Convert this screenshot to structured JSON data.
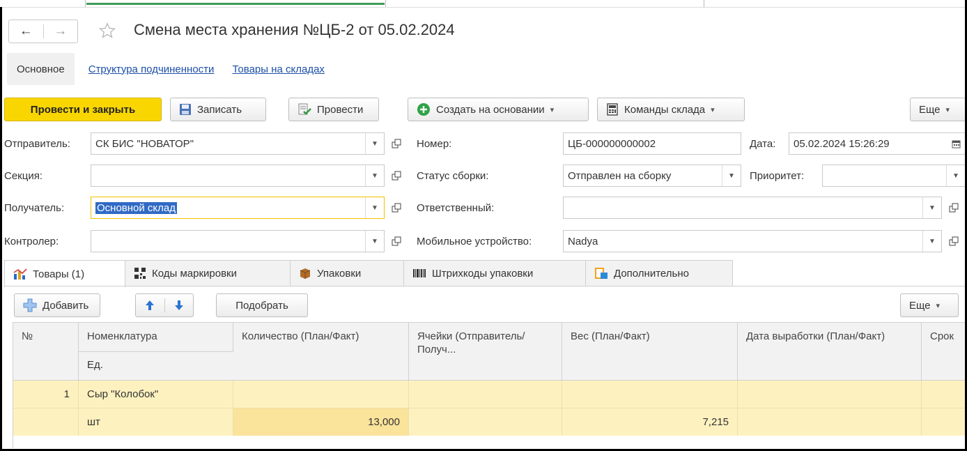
{
  "window": {
    "title": "Смена места хранения №ЦБ-2 от 05.02.2024"
  },
  "nav": {
    "back": "←",
    "forward": "→"
  },
  "top_tabs": {
    "main": "Основное",
    "links": [
      "Структура подчиненности",
      "Товары на складах"
    ]
  },
  "toolbar": {
    "post_close": "Провести и закрыть",
    "save": "Записать",
    "post": "Провести",
    "create_based": "Создать на основании",
    "warehouse_cmds": "Команды склада",
    "more": "Еще"
  },
  "form": {
    "sender_label": "Отправитель:",
    "sender_value": "СК БИС \"НОВАТОР\"",
    "section_label": "Секция:",
    "section_value": "",
    "receiver_label": "Получатель:",
    "receiver_value": "Основной склад",
    "controller_label": "Контролер:",
    "controller_value": "",
    "number_label": "Номер:",
    "number_value": "ЦБ-000000000002",
    "date_label": "Дата:",
    "date_value": "05.02.2024 15:26:29",
    "assembly_label": "Статус сборки:",
    "assembly_value": "Отправлен на сборку",
    "priority_label": "Приоритет:",
    "priority_value": "",
    "responsible_label": "Ответственный:",
    "responsible_value": "",
    "mobile_label": "Мобильное устройство:",
    "mobile_value": "Nadya"
  },
  "inner_tabs": [
    {
      "label": "Товары (1)",
      "icon": "chart-icon"
    },
    {
      "label": "Коды маркировки",
      "icon": "qr-icon"
    },
    {
      "label": "Упаковки",
      "icon": "box-icon"
    },
    {
      "label": "Штрихкоды упаковки",
      "icon": "barcode-icon"
    },
    {
      "label": "Дополнительно",
      "icon": "doc-icon"
    }
  ],
  "grid_toolbar": {
    "add": "Добавить",
    "pick": "Подобрать",
    "more": "Еще"
  },
  "grid": {
    "headers": {
      "num": "№",
      "nomen": "Номенклатура",
      "unit": "Ед.",
      "qty": "Количество (План/Факт)",
      "cells": "Ячейки (Отправитель/Получ...",
      "weight": "Вес (План/Факт)",
      "date": "Дата выработки (План/Факт)",
      "term": "Срок"
    },
    "rows": [
      {
        "num": "1",
        "nomen": "Сыр \"Колобок\"",
        "unit": "шт",
        "qty": "13,000",
        "cells": "",
        "weight": "7,215",
        "date": ""
      }
    ]
  },
  "colors": {
    "primary_button": "#f9d600",
    "link": "#1c4fa8",
    "row_highlight": "#fdf1bf"
  }
}
